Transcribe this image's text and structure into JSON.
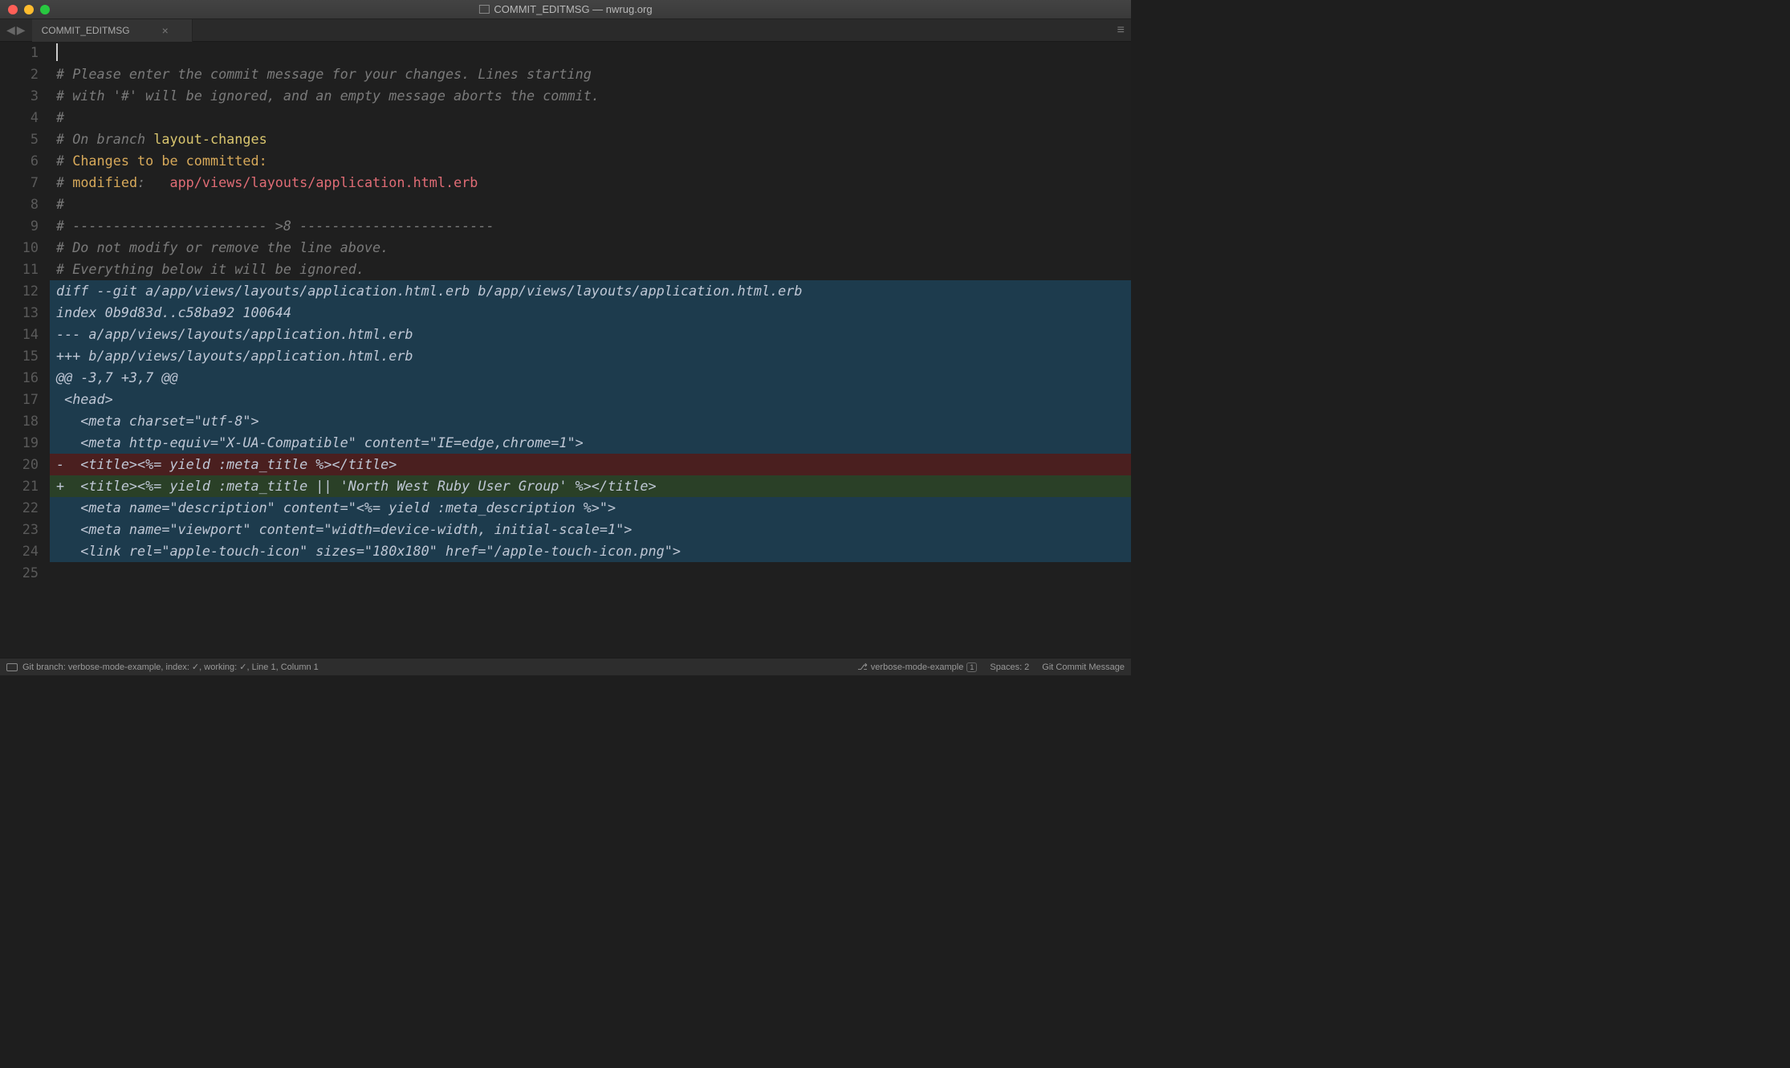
{
  "titlebar": {
    "title": "COMMIT_EDITMSG — nwrug.org"
  },
  "tabs": {
    "active": "COMMIT_EDITMSG"
  },
  "lines": [
    {
      "n": 1,
      "cls": "",
      "cursor": true,
      "text": ""
    },
    {
      "n": 2,
      "cls": "c-comment",
      "text": "# Please enter the commit message for your changes. Lines starting"
    },
    {
      "n": 3,
      "cls": "c-comment",
      "text": "# with '#' will be ignored, and an empty message aborts the commit."
    },
    {
      "n": 4,
      "cls": "c-comment",
      "text": "#"
    },
    {
      "n": 5,
      "segments": [
        {
          "cls": "c-comment",
          "text": "# On branch "
        },
        {
          "cls": "c-branch",
          "text": "layout-changes"
        }
      ]
    },
    {
      "n": 6,
      "segments": [
        {
          "cls": "c-comment",
          "text": "# "
        },
        {
          "cls": "c-heading",
          "text": "Changes to be committed:"
        }
      ]
    },
    {
      "n": 7,
      "segments": [
        {
          "cls": "c-comment",
          "text": "# "
        },
        {
          "cls": "c-heading c-mod-label",
          "text": "modified"
        },
        {
          "cls": "c-comment",
          "text": ":   "
        },
        {
          "cls": "c-file",
          "text": "app/views/layouts/application.html.erb"
        }
      ]
    },
    {
      "n": 8,
      "cls": "c-comment",
      "text": "#"
    },
    {
      "n": 9,
      "cls": "c-comment",
      "text": "# ------------------------ >8 ------------------------"
    },
    {
      "n": 10,
      "cls": "c-comment",
      "text": "# Do not modify or remove the line above."
    },
    {
      "n": 11,
      "cls": "c-comment",
      "text": "# Everything below it will be ignored."
    },
    {
      "n": 12,
      "bg": "bg-diff",
      "cls": "c-diff-base",
      "text": "diff --git a/app/views/layouts/application.html.erb b/app/views/layouts/application.html.erb"
    },
    {
      "n": 13,
      "bg": "bg-diff",
      "cls": "c-diff-base",
      "text": "index 0b9d83d..c58ba92 100644"
    },
    {
      "n": 14,
      "bg": "bg-diff",
      "cls": "c-diff-base",
      "text": "--- a/app/views/layouts/application.html.erb"
    },
    {
      "n": 15,
      "bg": "bg-diff",
      "cls": "c-diff-base",
      "text": "+++ b/app/views/layouts/application.html.erb"
    },
    {
      "n": 16,
      "bg": "bg-diff",
      "cls": "c-diff-base",
      "text": "@@ -3,7 +3,7 @@"
    },
    {
      "n": 17,
      "bg": "bg-diff",
      "cls": "c-diff-base",
      "text": " <head>"
    },
    {
      "n": 18,
      "bg": "bg-diff",
      "cls": "c-diff-base",
      "text": "   <meta charset=\"utf-8\">"
    },
    {
      "n": 19,
      "bg": "bg-diff",
      "cls": "c-diff-base",
      "text": "   <meta http-equiv=\"X-UA-Compatible\" content=\"IE=edge,chrome=1\">"
    },
    {
      "n": 20,
      "bg": "bg-del",
      "cls": "c-diff-base",
      "text": "-  <title><%= yield :meta_title %></title>"
    },
    {
      "n": 21,
      "bg": "bg-add",
      "cls": "c-diff-base",
      "text": "+  <title><%= yield :meta_title || 'North West Ruby User Group' %></title>"
    },
    {
      "n": 22,
      "bg": "bg-diff",
      "cls": "c-diff-base",
      "text": "   <meta name=\"description\" content=\"<%= yield :meta_description %>\">"
    },
    {
      "n": 23,
      "bg": "bg-diff",
      "cls": "c-diff-base",
      "text": "   <meta name=\"viewport\" content=\"width=device-width, initial-scale=1\">"
    },
    {
      "n": 24,
      "bg": "bg-diff",
      "cls": "c-diff-base",
      "text": "   <link rel=\"apple-touch-icon\" sizes=\"180x180\" href=\"/apple-touch-icon.png\">"
    },
    {
      "n": 25,
      "cls": "",
      "text": ""
    }
  ],
  "statusbar": {
    "left": "Git branch: verbose-mode-example, index: ✓, working: ✓, Line 1, Column 1",
    "branch": "verbose-mode-example",
    "badge": "1",
    "spaces": "Spaces: 2",
    "syntax": "Git Commit Message"
  }
}
